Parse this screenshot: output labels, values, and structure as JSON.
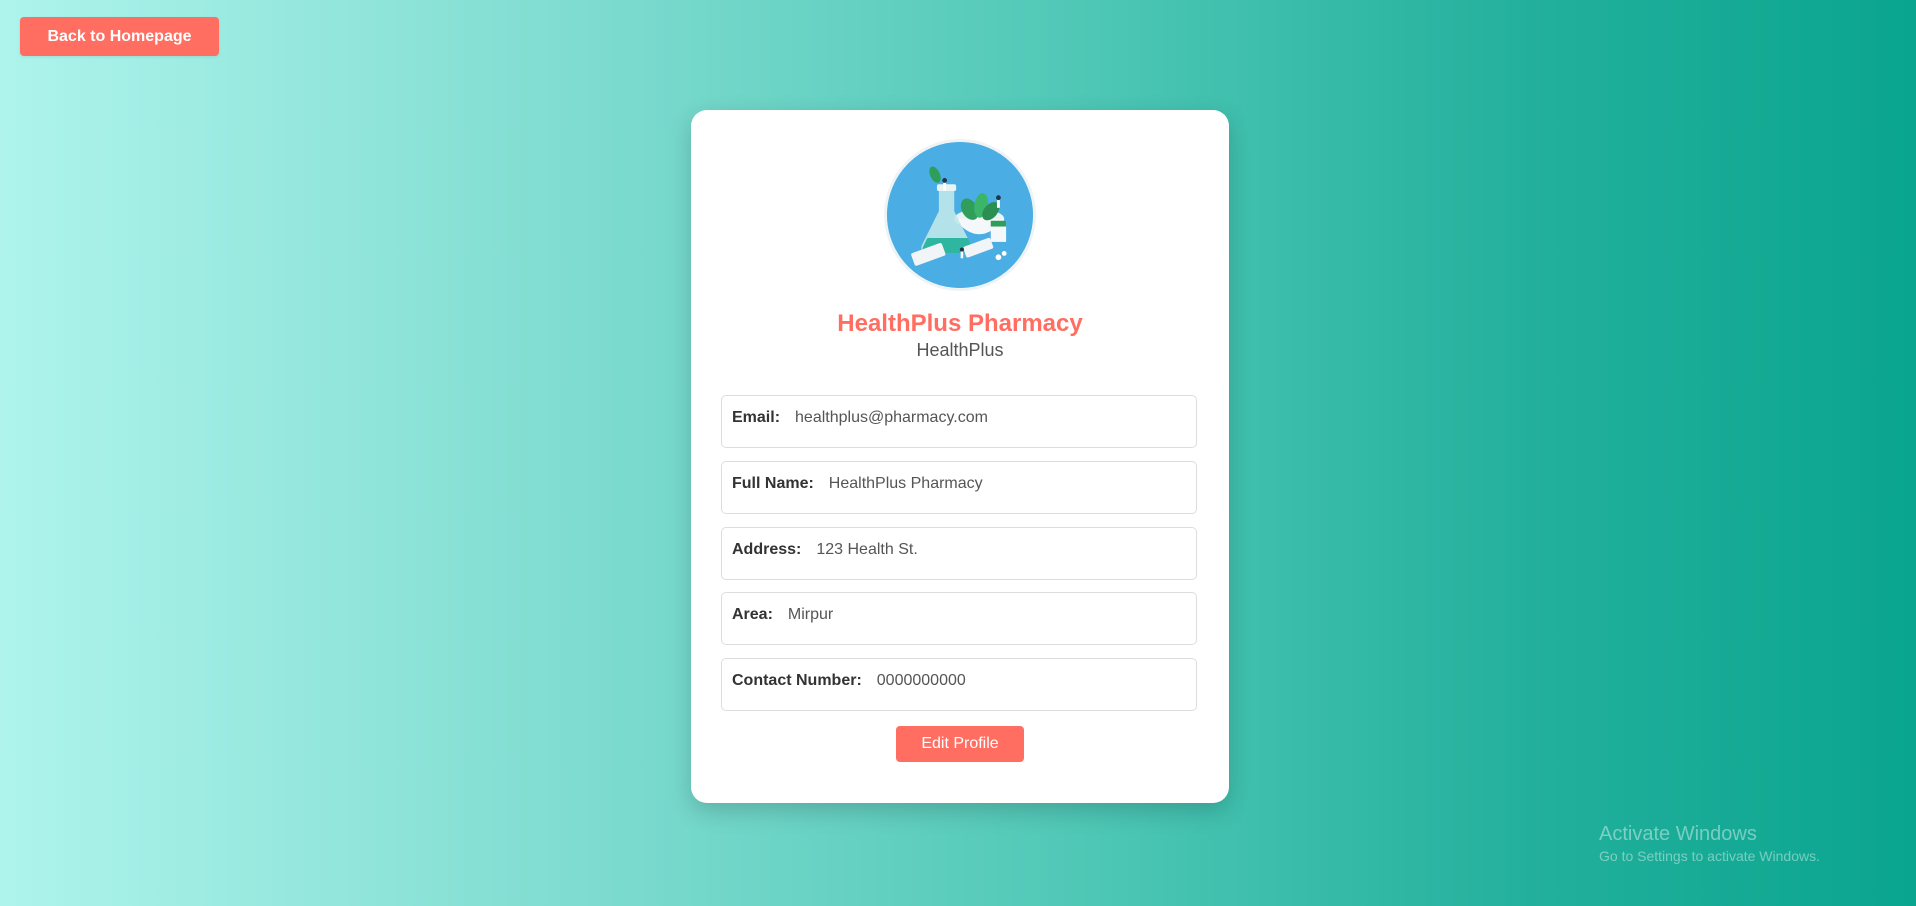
{
  "header": {
    "back_label": "Back to Homepage"
  },
  "profile": {
    "name": "HealthPlus Pharmacy",
    "username": "HealthPlus",
    "avatar_icon": "pharmacy-illustration-icon",
    "fields": [
      {
        "label": "Email:",
        "value": "healthplus@pharmacy.com"
      },
      {
        "label": "Full Name:",
        "value": "HealthPlus Pharmacy"
      },
      {
        "label": "Address:",
        "value": "123 Health St."
      },
      {
        "label": "Area:",
        "value": "Mirpur"
      },
      {
        "label": "Contact Number:",
        "value": "0000000000"
      }
    ],
    "edit_label": "Edit Profile"
  },
  "watermark": {
    "title": "Activate Windows",
    "subtitle": "Go to Settings to activate Windows."
  },
  "colors": {
    "accent": "#ff6e61",
    "avatar_bg": "#4aade3",
    "gradient_start": "#aef4ec",
    "gradient_end": "#0aa58f"
  }
}
